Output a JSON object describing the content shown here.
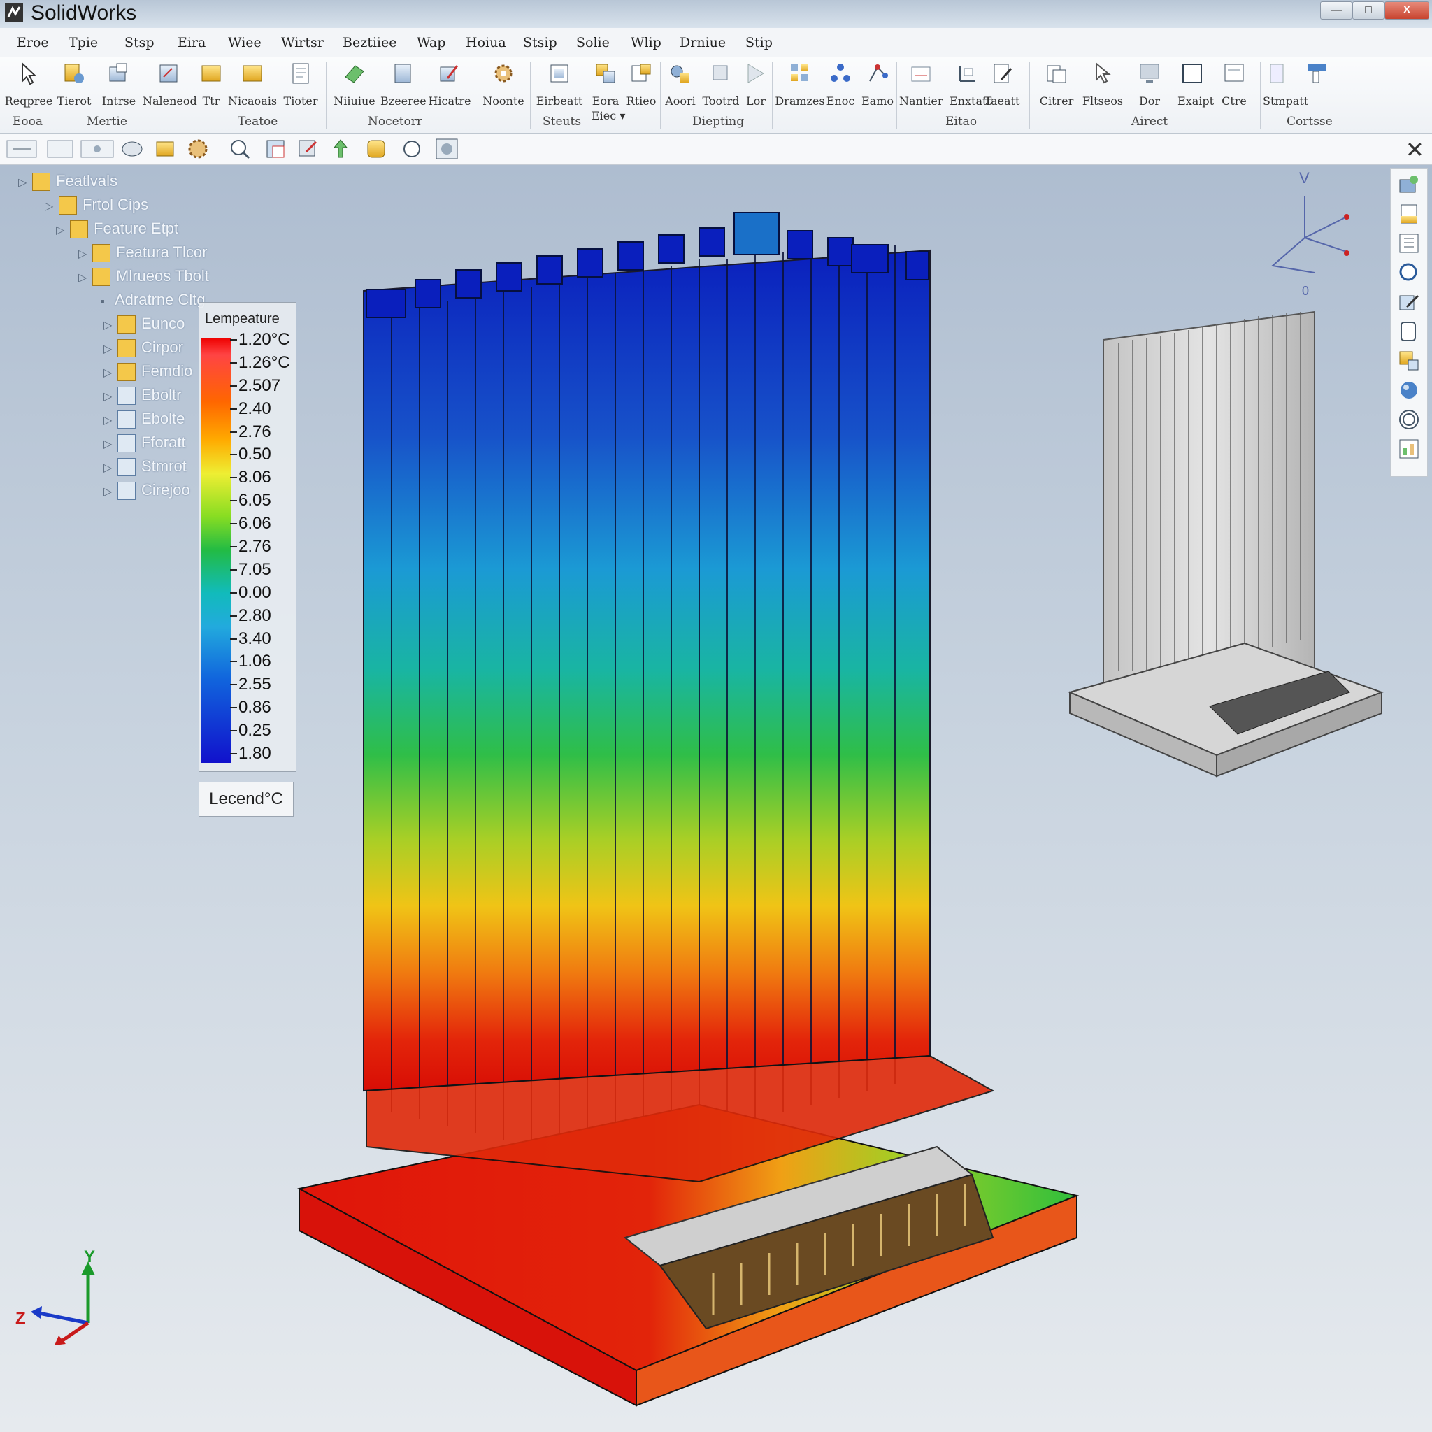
{
  "app": {
    "title": "SolidWorks"
  },
  "window": {
    "minimize": "—",
    "maximize": "□",
    "close": "X"
  },
  "menu": [
    "Eroe",
    "Tpie",
    "Stsp",
    "Eira",
    "Wiee",
    "Wirtsr",
    "Beztiiee",
    "Wap",
    "Hoiua",
    "Stsip",
    "Solie",
    "Wlip",
    "Drniue",
    "Stip"
  ],
  "ribbon": {
    "buttons": [
      "Reqpree",
      "Tierot",
      "Intrse",
      "Naleneod",
      "Ttr",
      "Nicaoais",
      "Tioter",
      "Niiuiue",
      "Bzeeree",
      "Hicatre",
      "Noonte",
      "Eirbeatt",
      "Eora",
      "Rtieo",
      "Aoori",
      "Tootrd",
      "Lor",
      "Dramzes",
      "Enoc",
      "Eamo",
      "Nantier",
      "Enxtatt",
      "Taeatt",
      "Citrer",
      "Fltseos",
      "Dor",
      "Exaipt",
      "Ctre",
      "Stmpatt"
    ],
    "extra_label": "Eiec ▾",
    "groups": [
      "Eooa",
      "Mertie",
      "Teatoe",
      "Nocetorr",
      "Steuts",
      "Diepting",
      "Eitao",
      "Airect",
      "Cortsse"
    ]
  },
  "tree": {
    "items": [
      "Featlvals",
      "Frtol Cips",
      "Feature Etpt",
      "Featura Tlcor",
      "Mlrueos Tbolt",
      "Adratrne Cltg",
      "Eunco",
      "Cirpor",
      "Femdio",
      "Eboltr",
      "Ebolte",
      "Fforatt",
      "Stmrot",
      "Cirejoo"
    ]
  },
  "legend": {
    "title": "Lempeature",
    "values": [
      "1.20°C",
      "1.26°C",
      "2.507",
      "2.40",
      "2.76",
      "0.50",
      "8.06",
      "6.05",
      "6.06",
      "2.76",
      "7.05",
      "0.00",
      "2.80",
      "3.40",
      "1.06",
      "2.55",
      "0.86",
      "0.25",
      "1.80"
    ],
    "unit_label": "Lecend°C"
  },
  "triad": {
    "y": "Y",
    "z": "Z",
    "mini_v": "V",
    "mini_o": "0"
  },
  "colors": {
    "hot": "#e30000",
    "cold": "#0010c8",
    "accent": "#2a6fb5"
  },
  "icons": {
    "viewbar": [
      "view-orientation-icon",
      "display-style-icon",
      "section-view-icon",
      "hide-show-icon",
      "edit-appearance-icon",
      "scene-icon",
      "zoom-icon",
      "zoom-fit-icon",
      "rotate-icon",
      "pan-icon",
      "zoom-area-icon",
      "search-icon",
      "render-tools-icon"
    ],
    "right": [
      "home-icon",
      "view-palette-icon",
      "design-library-icon",
      "file-explorer-icon",
      "edit-icon",
      "custom-properties-icon",
      "appearance-icon",
      "scene-sphere-icon",
      "decal-icon",
      "results-icon"
    ]
  }
}
